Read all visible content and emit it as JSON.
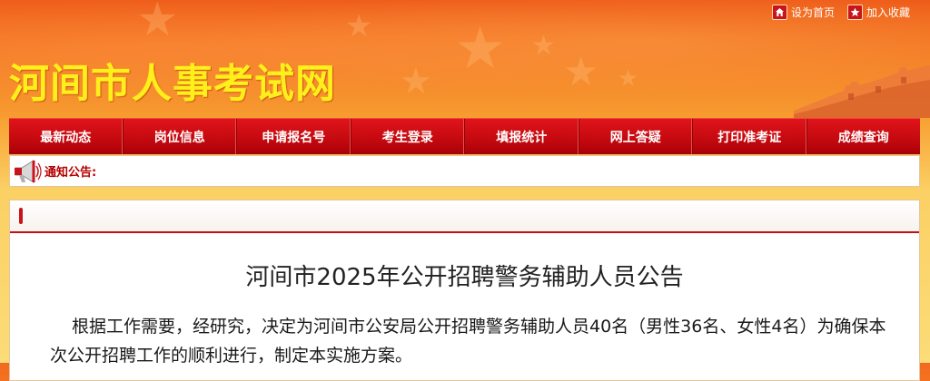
{
  "header": {
    "site_title": "河间市人事考试网",
    "links": [
      {
        "label": "设为首页",
        "icon": "home-icon"
      },
      {
        "label": "加入收藏",
        "icon": "star-icon"
      }
    ]
  },
  "nav": {
    "items": [
      {
        "label": "最新动态"
      },
      {
        "label": "岗位信息"
      },
      {
        "label": "申请报名号"
      },
      {
        "label": "考生登录"
      },
      {
        "label": "填报统计"
      },
      {
        "label": "网上答疑"
      },
      {
        "label": "打印准考证"
      },
      {
        "label": "成绩查询"
      }
    ]
  },
  "notice": {
    "label": "通知公告:",
    "icon": "megaphone-icon"
  },
  "article": {
    "title": "河间市2025年公开招聘警务辅助人员公告",
    "paragraph": "根据工作需要，经研究，决定为河间市公安局公开招聘警务辅助人员40名（男性36名、女性4名）为确保本次公开招聘工作的顺利进行，制定本实施方案。"
  },
  "colors": {
    "nav_red": "#c60a10",
    "title_yellow": "#ffef1a",
    "banner_orange": "#f2701f",
    "page_bg_yellow": "#fbd064"
  }
}
